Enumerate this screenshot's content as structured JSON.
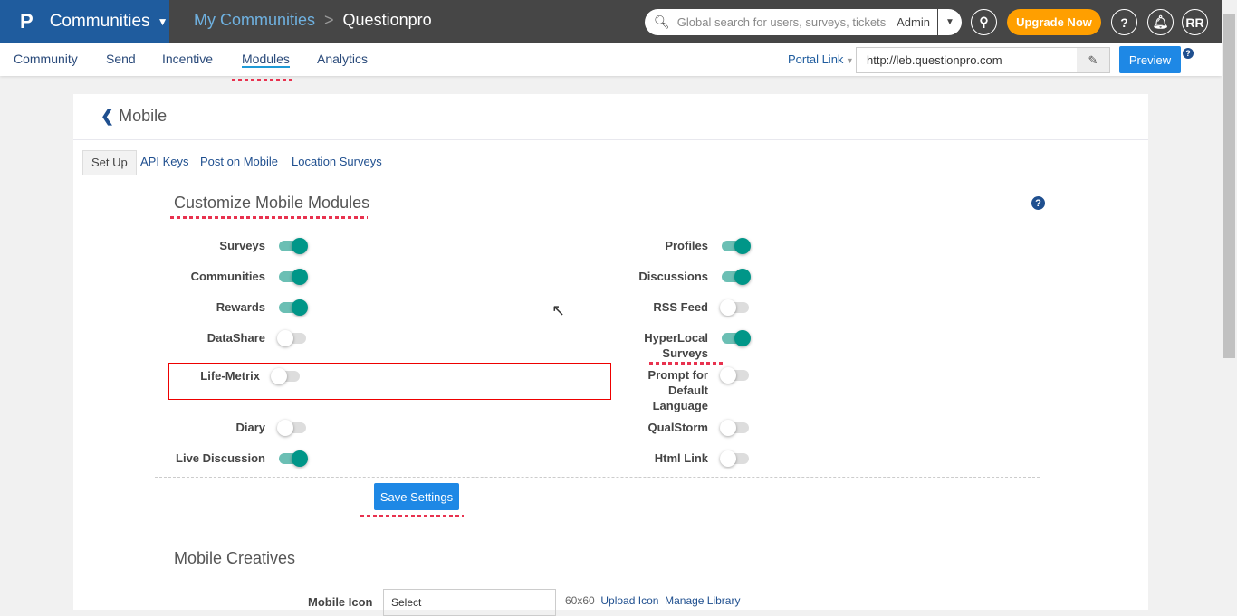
{
  "topbar": {
    "product": "Communities",
    "breadcrumb": [
      "My Communities",
      "Questionpro"
    ],
    "search_placeholder": "Global search for users, surveys, tickets",
    "search_scope": "Admin",
    "upgrade": "Upgrade Now",
    "avatar": "RR",
    "help": "?"
  },
  "nav": {
    "items": [
      "Community",
      "Send",
      "Incentive",
      "Modules",
      "Analytics"
    ],
    "active": "Modules",
    "portal_link": "Portal Link",
    "portal_url": "http://leb.questionpro.com",
    "preview": "Preview"
  },
  "page": {
    "title": "Mobile",
    "tabs": [
      "Set Up",
      "API Keys",
      "Post on Mobile",
      "Location Surveys"
    ],
    "section_title": "Customize Mobile Modules",
    "save": "Save Settings",
    "creatives_title": "Mobile Creatives",
    "creatives_row": {
      "label": "Mobile Icon",
      "select": "Select",
      "hint": "60x60",
      "upload": "Upload Icon",
      "library": "Manage Library"
    }
  },
  "modules_left": [
    {
      "label": "Surveys",
      "on": true
    },
    {
      "label": "Communities",
      "on": true
    },
    {
      "label": "Rewards",
      "on": true
    },
    {
      "label": "DataShare",
      "on": false
    },
    {
      "label": "Life-Metrix",
      "on": false
    },
    {
      "label": "Diary",
      "on": false
    },
    {
      "label": "Live Discussion",
      "on": true
    }
  ],
  "modules_right": [
    {
      "label": "Profiles",
      "on": true
    },
    {
      "label": "Discussions",
      "on": true
    },
    {
      "label": "RSS Feed",
      "on": false
    },
    {
      "label": "HyperLocal Surveys",
      "on": true
    },
    {
      "label": "Prompt for Default Language",
      "on": false
    },
    {
      "label": "QualStorm",
      "on": false
    },
    {
      "label": "Html Link",
      "on": false
    }
  ],
  "colors": {
    "brand": "#1f5c9e",
    "accent": "#1e88e5",
    "toggle_on": "#009688",
    "upgrade": "#ff9f00"
  }
}
